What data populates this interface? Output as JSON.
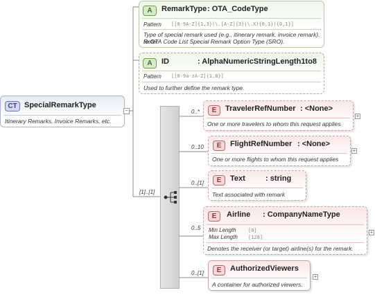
{
  "complex_type": {
    "badge": "CT",
    "name": "SpecialRemarkType",
    "description": "Itinerary Remarks, Invoice Remarks, etc."
  },
  "attributes": [
    {
      "badge": "A",
      "name": "RemarkType",
      "type": ": OTA_CodeType",
      "facet_label": "Pattern",
      "facet_value": "[[0-9A-Z]{1,3}(\\.[A-Z]{3}(\\.X){0,1}){0,1}]",
      "description_line1": "Type of special remark used (e.g., itinerary remark, invoice remark). Refer",
      "description_line2": "to OTA Code List Special Remark Option Type (SRO)."
    },
    {
      "badge": "A",
      "name": "ID",
      "type": ": AlphaNumericStringLength1to8",
      "facet_label": "Pattern",
      "facet_value": "[[0-9a-zA-Z]{1,8}]",
      "description_line1": "Used to further define the remark type."
    }
  ],
  "sequence": {
    "cardinality": "[1]..[1]",
    "icon": "sequence-icon"
  },
  "elements": [
    {
      "badge": "E",
      "name": "TravelerRefNumber",
      "type": ": <None>",
      "cardinality": "0..*",
      "description": "One or more travelers to whom this request applies"
    },
    {
      "badge": "E",
      "name": "FlightRefNumber",
      "type": ": <None>",
      "cardinality": "0..10",
      "description": "One or more flights to whom this request applies"
    },
    {
      "badge": "E",
      "name": "Text",
      "type": ": string",
      "cardinality": "0..[1]",
      "description": "Text associated with remark"
    },
    {
      "badge": "E",
      "name": "Airline",
      "type": ": CompanyNameType",
      "cardinality": "0..5",
      "facet1_label": "Min Length",
      "facet1_value": "[0]",
      "facet2_label": "Max Length",
      "facet2_value": "[128]",
      "description": "Denotes the receiver (or target) airline(s) for the remark."
    },
    {
      "badge": "E",
      "name": "AuthorizedViewers",
      "cardinality": "0..[1]",
      "description": "A container for authorized viewers."
    }
  ],
  "colors": {
    "attribute": "#d6ecc8",
    "element": "#f5d5d5",
    "complex_type": "#d4d9f0"
  }
}
